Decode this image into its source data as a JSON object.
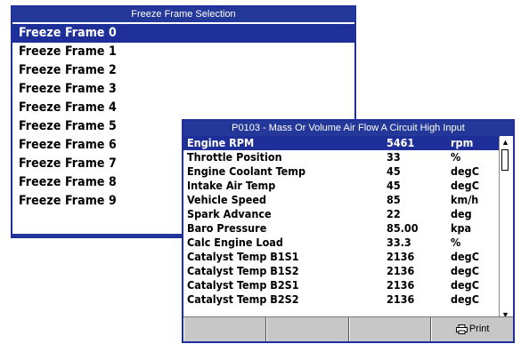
{
  "freeze_frame_window": {
    "title": "Freeze Frame Selection",
    "items": [
      {
        "label": "Freeze Frame 0",
        "selected": true
      },
      {
        "label": "Freeze Frame 1",
        "selected": false
      },
      {
        "label": "Freeze Frame 2",
        "selected": false
      },
      {
        "label": "Freeze Frame 3",
        "selected": false
      },
      {
        "label": "Freeze Frame 4",
        "selected": false
      },
      {
        "label": "Freeze Frame 5",
        "selected": false
      },
      {
        "label": "Freeze Frame 6",
        "selected": false
      },
      {
        "label": "Freeze Frame 7",
        "selected": false
      },
      {
        "label": "Freeze Frame 8",
        "selected": false
      },
      {
        "label": "Freeze Frame 9",
        "selected": false
      }
    ]
  },
  "pid_window": {
    "title": "P0103 - Mass Or Volume Air Flow A Circuit High Input",
    "rows": [
      {
        "name": "Engine RPM",
        "value": "5461",
        "unit": "rpm",
        "selected": true
      },
      {
        "name": "Throttle Position",
        "value": "33",
        "unit": "%",
        "selected": false
      },
      {
        "name": "Engine Coolant Temp",
        "value": "45",
        "unit": "degC",
        "selected": false
      },
      {
        "name": "Intake Air Temp",
        "value": "45",
        "unit": "degC",
        "selected": false
      },
      {
        "name": "Vehicle Speed",
        "value": "85",
        "unit": "km/h",
        "selected": false
      },
      {
        "name": "Spark Advance",
        "value": "22",
        "unit": "deg",
        "selected": false
      },
      {
        "name": "Baro Pressure",
        "value": "85.00",
        "unit": "kpa",
        "selected": false
      },
      {
        "name": "Calc Engine Load",
        "value": "33.3",
        "unit": "%",
        "selected": false
      },
      {
        "name": "Catalyst Temp B1S1",
        "value": "2136",
        "unit": "degC",
        "selected": false
      },
      {
        "name": "Catalyst Temp B1S2",
        "value": "2136",
        "unit": "degC",
        "selected": false
      },
      {
        "name": "Catalyst Temp B2S1",
        "value": "2136",
        "unit": "degC",
        "selected": false
      },
      {
        "name": "Catalyst Temp B2S2",
        "value": "2136",
        "unit": "degC",
        "selected": false
      }
    ],
    "softkeys": [
      "",
      "",
      "",
      "Print"
    ],
    "print_icon": "printer-icon"
  },
  "colors": {
    "title_bar": "#24389a",
    "selection": "#1f2f9a",
    "softkey_bar": "#c7c7c7"
  }
}
